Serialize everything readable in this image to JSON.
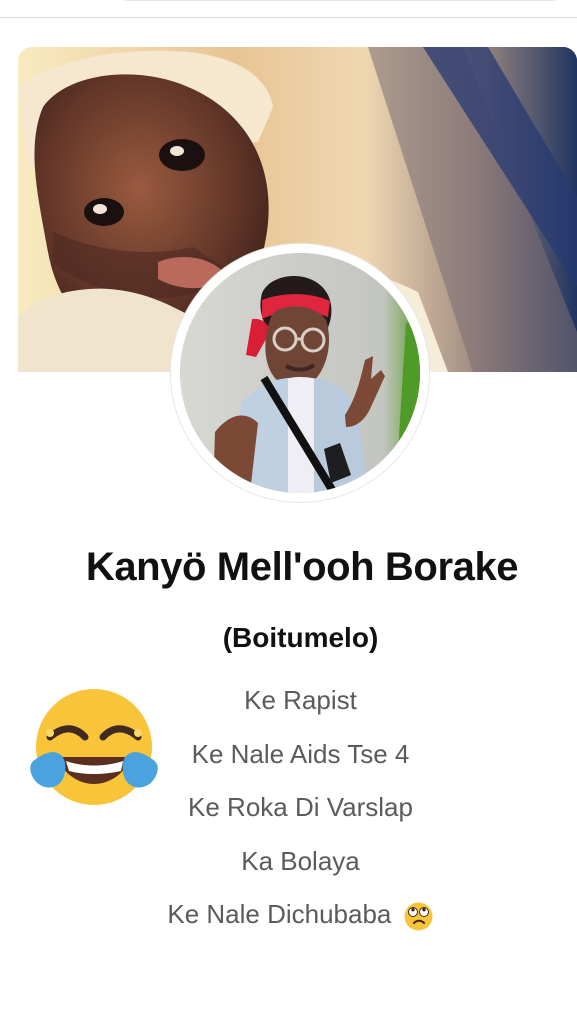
{
  "profile": {
    "name": "Kanyö Mell'ooh Borake",
    "alias": "(Boitumelo)",
    "bio_lines": [
      "Ke Rapist",
      "Ke Nale Aids Tse 4",
      "Ke Roka Di Varslap",
      "Ka Bolaya",
      "Ke Nale Dichubaba"
    ]
  },
  "emojis": {
    "large_reaction": "face-with-tears-of-joy",
    "inline_reaction": "face-with-rolling-eyes"
  },
  "colors": {
    "name_text": "#111111",
    "bio_text": "#5b5b5b",
    "emoji_yellow": "#f8c43a",
    "tears_blue": "#4aa3df"
  }
}
